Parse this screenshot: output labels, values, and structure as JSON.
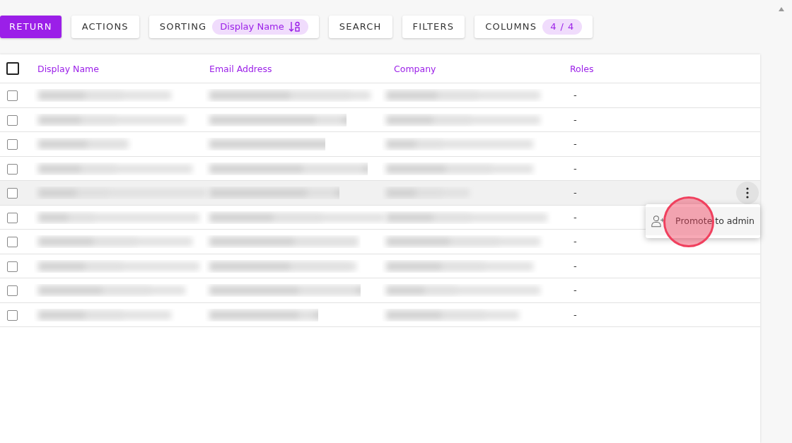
{
  "toolbar": {
    "return": "RETURN",
    "actions": "ACTIONS",
    "sorting": {
      "label": "SORTING",
      "value": "Display Name"
    },
    "search": "SEARCH",
    "filters": "FILTERS",
    "columns": {
      "label": "COLUMNS",
      "count": "4 / 4"
    }
  },
  "table": {
    "select_all": {
      "checked": false
    },
    "columns": [
      "Display Name",
      "Email Address",
      "Company",
      "Roles"
    ],
    "rows": [
      {
        "checked": false,
        "hovered": false,
        "roles": "-"
      },
      {
        "checked": false,
        "hovered": false,
        "roles": "-"
      },
      {
        "checked": false,
        "hovered": false,
        "roles": "-"
      },
      {
        "checked": false,
        "hovered": false,
        "roles": "-"
      },
      {
        "checked": false,
        "hovered": true,
        "roles": "-"
      },
      {
        "checked": false,
        "hovered": false,
        "roles": "-"
      },
      {
        "checked": false,
        "hovered": false,
        "roles": "-"
      },
      {
        "checked": false,
        "hovered": false,
        "roles": "-"
      },
      {
        "checked": false,
        "hovered": false,
        "roles": "-"
      },
      {
        "checked": false,
        "hovered": false,
        "roles": "-"
      }
    ]
  },
  "row_menu": {
    "open": true,
    "items": [
      "Promote to admin"
    ]
  }
}
